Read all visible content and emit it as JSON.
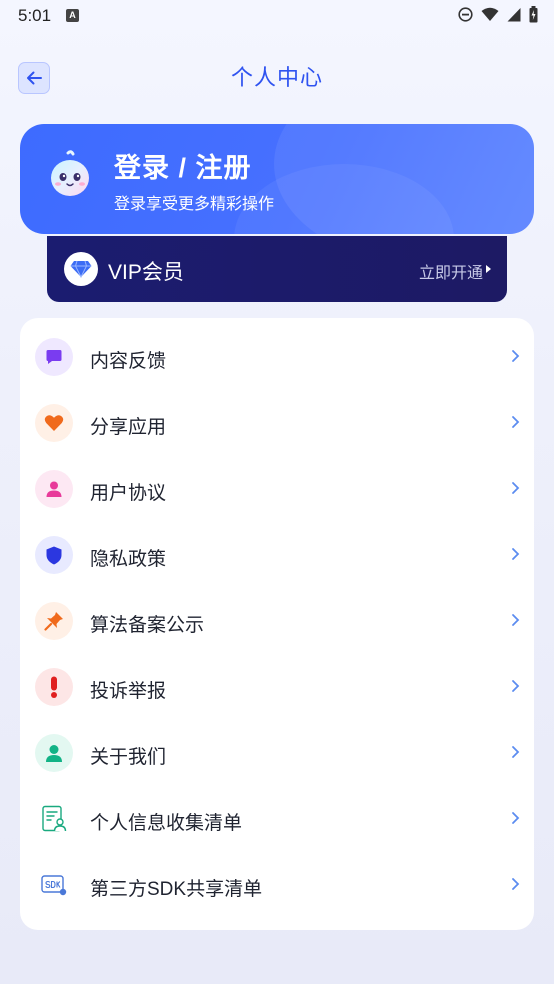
{
  "status": {
    "time": "5:01",
    "badge": "A"
  },
  "header": {
    "title": "个人中心"
  },
  "login": {
    "title": "登录 / 注册",
    "subtitle": "登录享受更多精彩操作"
  },
  "vip": {
    "label": "VIP会员",
    "action": "立即开通"
  },
  "menu": [
    {
      "label": "内容反馈",
      "icon": "chat-bubble-icon",
      "color": "#7a3cf0",
      "bg": "#efe8ff"
    },
    {
      "label": "分享应用",
      "icon": "heart-icon",
      "color": "#f06a1c",
      "bg": "#fff0e6"
    },
    {
      "label": "用户协议",
      "icon": "user-icon",
      "color": "#e83a9a",
      "bg": "#fde8f3"
    },
    {
      "label": "隐私政策",
      "icon": "shield-icon",
      "color": "#2b37e0",
      "bg": "#e8eaff"
    },
    {
      "label": "算法备案公示",
      "icon": "pin-icon",
      "color": "#f06a1c",
      "bg": "#fff0e6"
    },
    {
      "label": "投诉举报",
      "icon": "exclamation-icon",
      "color": "#e02020",
      "bg": "#fde6e6"
    },
    {
      "label": "关于我们",
      "icon": "person-icon",
      "color": "#12b386",
      "bg": "#e3f8f1"
    },
    {
      "label": "个人信息收集清单",
      "icon": "document-user-icon",
      "color": "#19a97f",
      "bg": "#ffffff"
    },
    {
      "label": "第三方SDK共享清单",
      "icon": "sdk-icon",
      "color": "#4a78d8",
      "bg": "#ffffff"
    }
  ]
}
